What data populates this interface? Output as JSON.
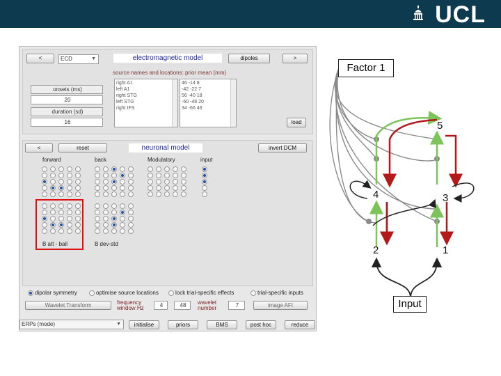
{
  "header": {
    "logo_text": "UCL",
    "bar_color": "#0d3a4f"
  },
  "em_panel": {
    "prev_label": "<",
    "next_label": ">",
    "data_type": "ECD",
    "title": "electromagnetic model",
    "dipoles_label": "dipoles",
    "sources_title": "source names and locations: prior mean (mm)",
    "onsets_label": "onsets (ms)",
    "onsets_value": "20",
    "duration_label": "duration (sd)",
    "duration_value": "16",
    "sources": [
      "right A1",
      "left A1",
      "right STG",
      "left STG",
      "right IFS"
    ],
    "locations": [
      "46 -14 8",
      "-42 -22 7",
      "56 -40 18",
      "-60 -48 20",
      "34 -66 46"
    ],
    "load_label": "load"
  },
  "neuronal_panel": {
    "prev_label": "<",
    "reset_label": "reset",
    "title": "neuronal model",
    "invert_label": "invert DCM",
    "col_forward": "forward",
    "col_back": "back",
    "col_modulatory": "Modulatory",
    "col_input": "input",
    "cond_a": "B att - ball",
    "cond_b": "B dev-std"
  },
  "options": {
    "dipolar_symmetry": "dipolar symmetry",
    "optimise": "optimise source locations",
    "lock": "lock trial-specific effects",
    "trial_specific": "trial-specific inputs"
  },
  "wavelet": {
    "transform_label": "Wavelet Transform",
    "frequency_label": "frequency window Hz",
    "freq_low": "4",
    "freq_high": "48",
    "wavelet_number_label": "wavelet number",
    "wavelet_number": "7",
    "image_label": "image AFI"
  },
  "bottom": {
    "mode": "ERPs (mode)",
    "initialise": "initialise",
    "priors": "priors",
    "bms": "BMS",
    "posthoc": "post hoc",
    "reduce": "reduce"
  },
  "diagram": {
    "factor_label": "Factor 1",
    "input_label": "Input",
    "nodes": [
      "5",
      "4",
      "3",
      "2",
      "1"
    ],
    "colors": {
      "forward": "#7cc45a",
      "backward": "#b3191b",
      "lateral": "#333333",
      "grey": "#8a8a8a"
    }
  }
}
